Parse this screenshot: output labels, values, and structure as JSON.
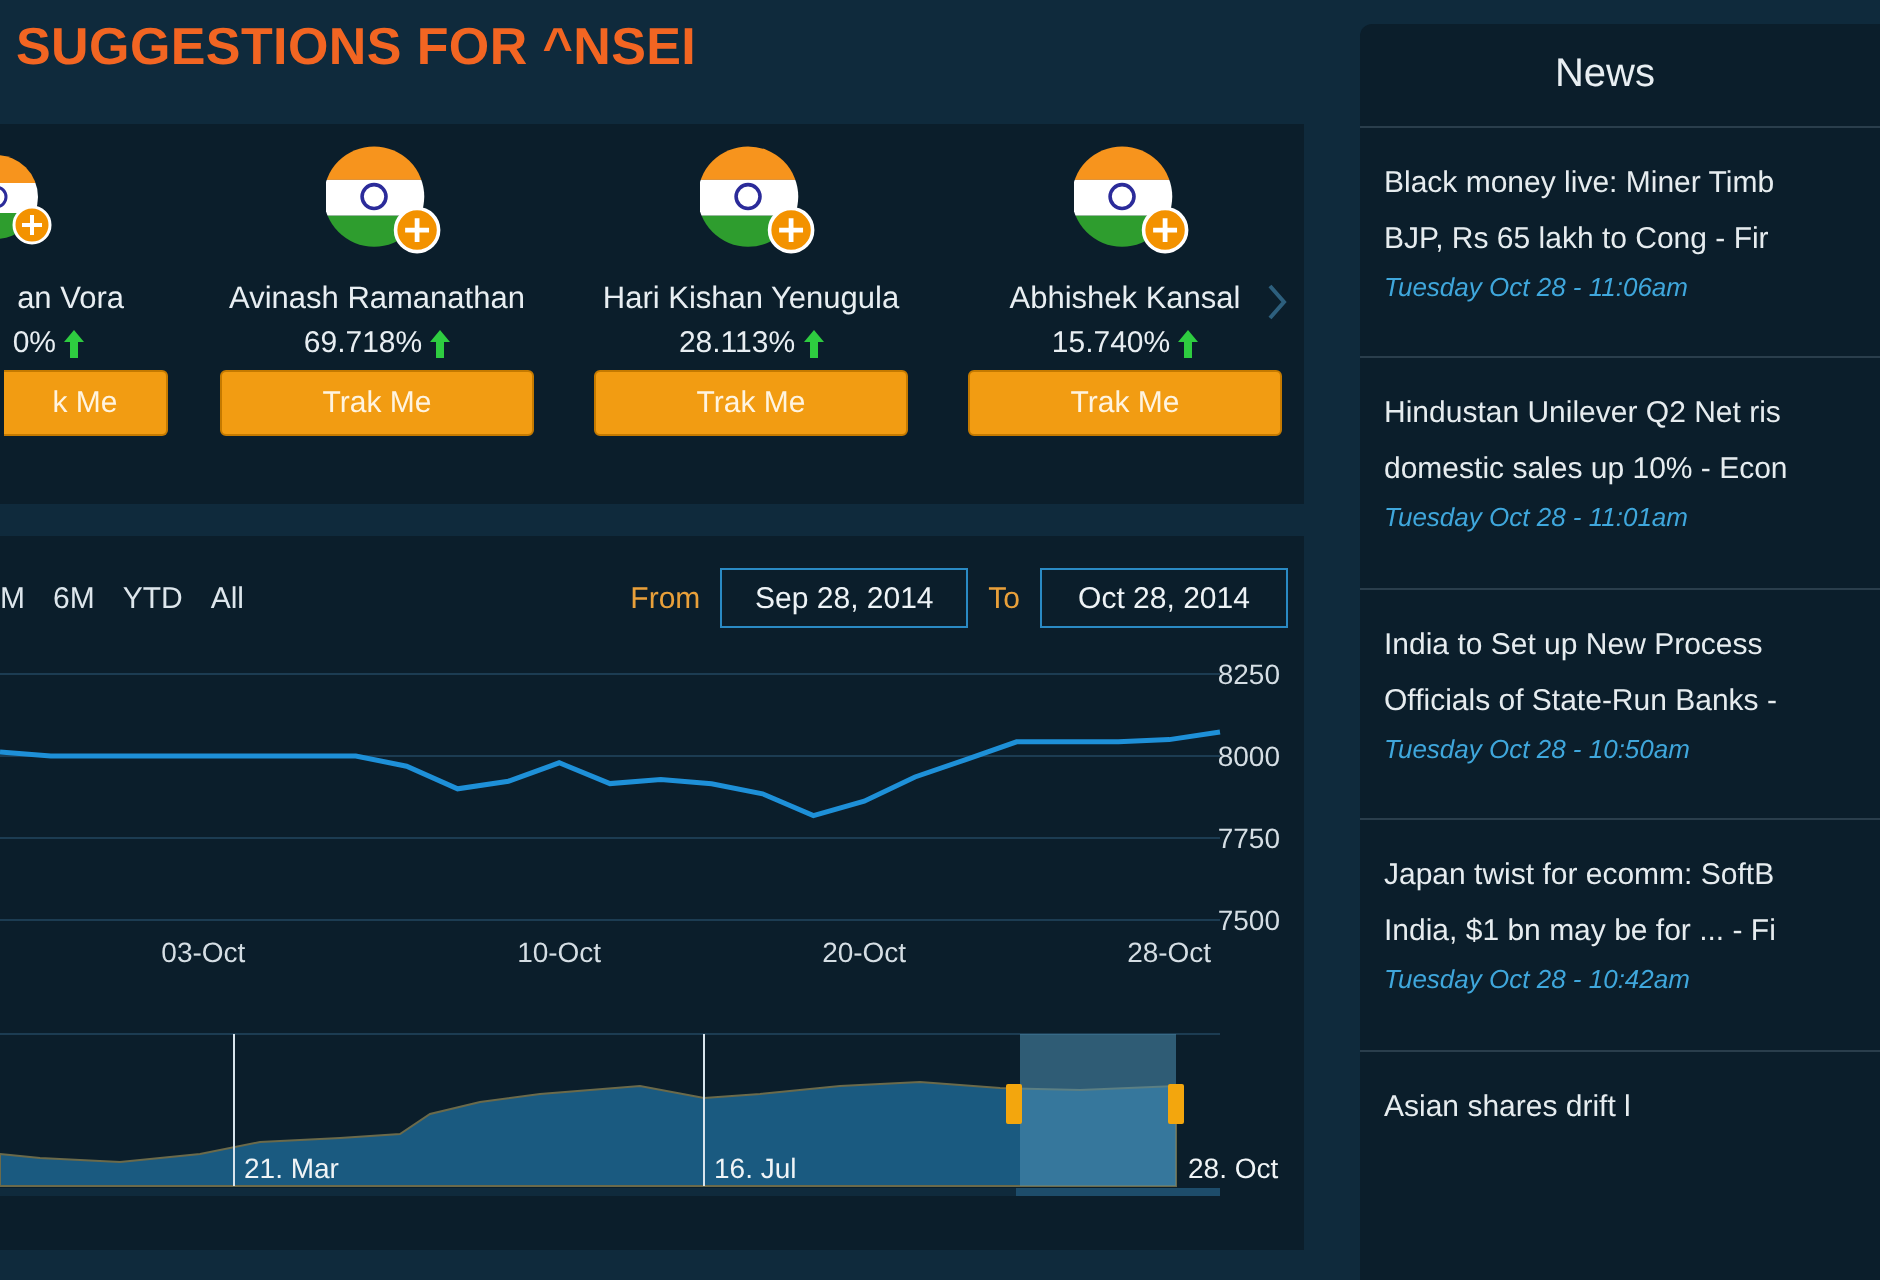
{
  "title": "SUGGESTIONS FOR ^NSEI",
  "suggestions": {
    "cards": [
      {
        "kind": "partial",
        "name": "an Vora",
        "change": "0%",
        "rising": true,
        "button": "k Me"
      },
      {
        "kind": "full",
        "name": "Avinash Ramanathan",
        "change": "69.718%",
        "rising": true,
        "button": "Trak Me"
      },
      {
        "kind": "full",
        "name": "Hari Kishan Yenugula",
        "change": "28.113%",
        "rising": true,
        "button": "Trak Me"
      },
      {
        "kind": "full",
        "name": "Abhishek Kansal",
        "change": "15.740%",
        "rising": true,
        "button": "Trak Me"
      }
    ]
  },
  "chart": {
    "range_buttons": [
      "M",
      "6M",
      "YTD",
      "All"
    ],
    "from_label": "From",
    "from_value": "Sep 28, 2014",
    "to_label": "To",
    "to_value": "Oct 28, 2014",
    "chart_data": {
      "type": "line",
      "categories": [
        null,
        null,
        null,
        null,
        "03-Oct",
        null,
        null,
        null,
        null,
        null,
        null,
        "10-Oct",
        null,
        null,
        null,
        null,
        null,
        "20-Oct",
        null,
        null,
        null,
        null,
        null,
        "28-Oct",
        null
      ],
      "series": [
        {
          "color": "#1e90d8",
          "values": [
            8012,
            8000,
            8000,
            8000,
            8000,
            8000,
            8000,
            8000,
            7969,
            7900,
            7923,
            7979,
            7916,
            7928,
            7915,
            7885,
            7818,
            7862,
            7936,
            7989,
            8043,
            8043,
            8043,
            8050,
            8073
          ]
        }
      ],
      "ylim": [
        7500,
        8250
      ],
      "yticks": [
        7500,
        7750,
        8000,
        8250
      ]
    },
    "navigator_labels": [
      "21. Mar",
      "16. Jul",
      "28. Oct"
    ]
  },
  "news": {
    "tab": "News",
    "items": [
      {
        "lines": [
          "Black money live: Miner Timb",
          "BJP, Rs 65 lakh to Cong - Fir"
        ],
        "time": "Tuesday Oct 28 - 11:06am"
      },
      {
        "lines": [
          "Hindustan Unilever Q2 Net ris",
          "domestic sales up 10% - Econ"
        ],
        "time": "Tuesday Oct 28 - 11:01am"
      },
      {
        "lines": [
          "India to Set up New Process",
          "Officials of State-Run Banks -"
        ],
        "time": "Tuesday Oct 28 - 10:50am"
      },
      {
        "lines": [
          "Japan twist for ecomm: SoftB",
          "India, $1 bn may be for ... - Fi"
        ],
        "time": "Tuesday Oct 28 - 10:42am"
      },
      {
        "lines": [
          "Asian shares drift l"
        ]
      }
    ]
  }
}
